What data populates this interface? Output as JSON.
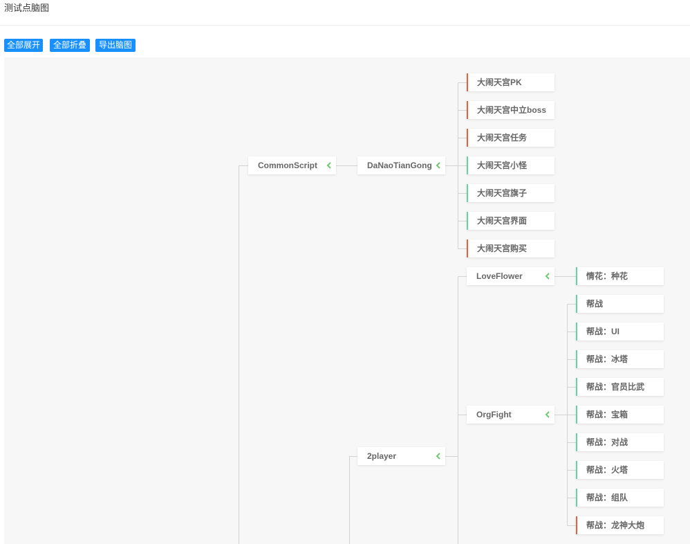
{
  "page": {
    "title": "测试点脑图"
  },
  "toolbar": {
    "expand_all_label": "全部展开",
    "collapse_all_label": "全部折叠",
    "export_label": "导出脑图"
  },
  "colors": {
    "accent": "#1890ff",
    "canvas": "#f7f7f7",
    "connector": "#d3d3d3",
    "chevron": "#71c671",
    "marker_red": "#e5603c",
    "marker_green": "#64d2a4"
  },
  "mindmap": {
    "branches": [
      {
        "label": "CommonScript",
        "toggle_icon": "chevron-left-icon",
        "children": [
          {
            "label": "DaNaoTianGong",
            "toggle_icon": "chevron-left-icon",
            "children": [
              {
                "label": "大闹天宫PK",
                "marker": "#e5603c"
              },
              {
                "label": "大闹天宫中立boss",
                "marker": "#e5603c"
              },
              {
                "label": "大闹天宫任务",
                "marker": "#e5603c"
              },
              {
                "label": "大闹天宫小怪",
                "marker": "#64d2a4"
              },
              {
                "label": "大闹天宫旗子",
                "marker": "#64d2a4"
              },
              {
                "label": "大闹天宫界面",
                "marker": "#64d2a4"
              },
              {
                "label": "大闹天宫购买",
                "marker": "#e5603c"
              }
            ]
          }
        ]
      },
      {
        "label": "2player",
        "toggle_icon": "chevron-left-icon",
        "children": [
          {
            "label": "LoveFlower",
            "toggle_icon": "chevron-left-icon",
            "children": [
              {
                "label": "情花：种花",
                "marker": "#64d2a4"
              }
            ]
          },
          {
            "label": "OrgFight",
            "toggle_icon": "chevron-left-icon",
            "children": [
              {
                "label": "帮战",
                "marker": "#64d2a4"
              },
              {
                "label": "帮战：UI",
                "marker": "#64d2a4"
              },
              {
                "label": "帮战：冰塔",
                "marker": "#64d2a4"
              },
              {
                "label": "帮战：官员比武",
                "marker": "#64d2a4"
              },
              {
                "label": "帮战：宝箱",
                "marker": "#64d2a4"
              },
              {
                "label": "帮战：对战",
                "marker": "#64d2a4"
              },
              {
                "label": "帮战：火塔",
                "marker": "#64d2a4"
              },
              {
                "label": "帮战：组队",
                "marker": "#64d2a4"
              },
              {
                "label": "帮战：龙神大炮",
                "marker": "#e5603c"
              }
            ]
          }
        ]
      }
    ]
  }
}
